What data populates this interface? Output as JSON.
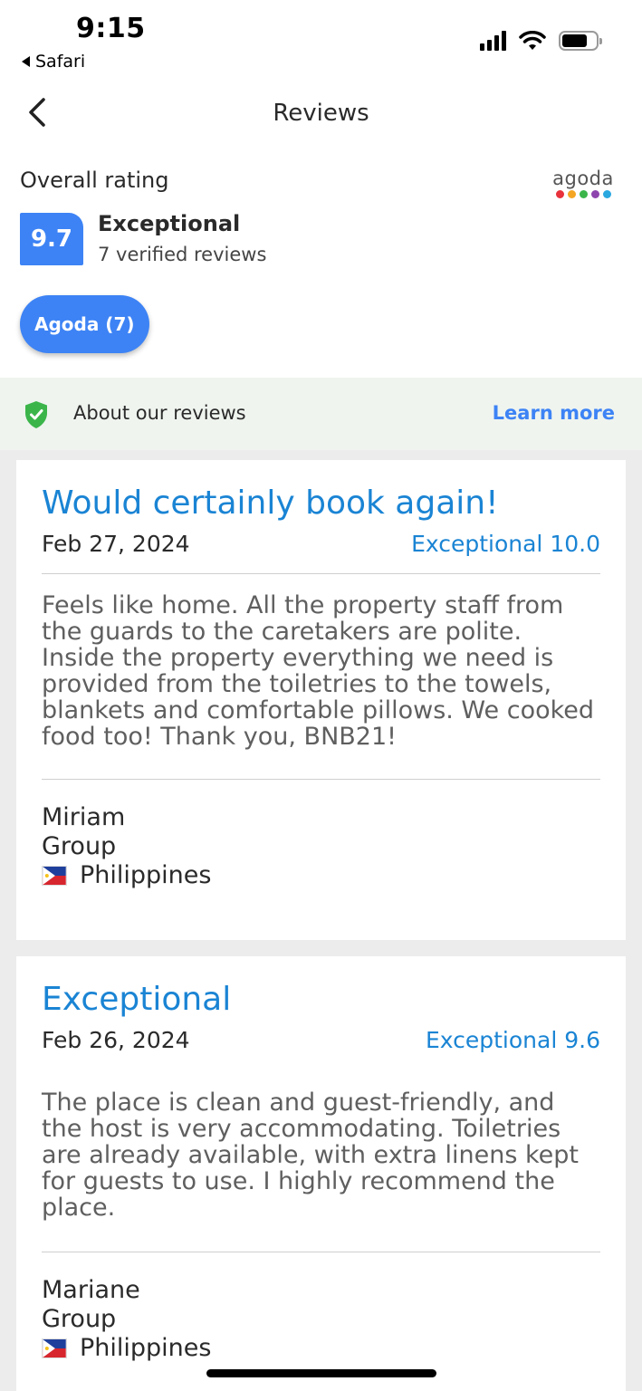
{
  "status_bar": {
    "time": "9:15",
    "back_app": "Safari"
  },
  "header": {
    "title": "Reviews"
  },
  "overall": {
    "label": "Overall rating",
    "score": "9.7",
    "rating_word": "Exceptional",
    "review_count": "7 verified reviews",
    "brand": "agoda",
    "brand_dot_colors": [
      "#e8323c",
      "#f4a623",
      "#3bb54a",
      "#8e44ad",
      "#2aa8e0"
    ]
  },
  "filter_chip": {
    "label": "Agoda (7)"
  },
  "about": {
    "label": "About our reviews",
    "link": "Learn more"
  },
  "colors": {
    "accent": "#3d83f5",
    "review_title": "#1a84d4",
    "shield_green": "#3bb54a"
  },
  "reviews": [
    {
      "title": "Would certainly book again!",
      "date": "Feb 27, 2024",
      "score": "Exceptional 10.0",
      "body": "Feels like home. All the property staff from the guards to the caretakers are polite. Inside the property everything we need is provided from the toiletries to the towels, blankets and comfortable pillows. We cooked food too! Thank you, BNB21!",
      "name": "Miriam",
      "traveler_type": "Group",
      "country": "Philippines"
    },
    {
      "title": "Exceptional",
      "date": "Feb 26, 2024",
      "score": "Exceptional 9.6",
      "body": "The place is clean and guest-friendly, and the host is very accommodating. Toiletries are already available, with extra linens kept for guests to use. I highly recommend the place.",
      "name": "Mariane",
      "traveler_type": "Group",
      "country": "Philippines"
    }
  ]
}
